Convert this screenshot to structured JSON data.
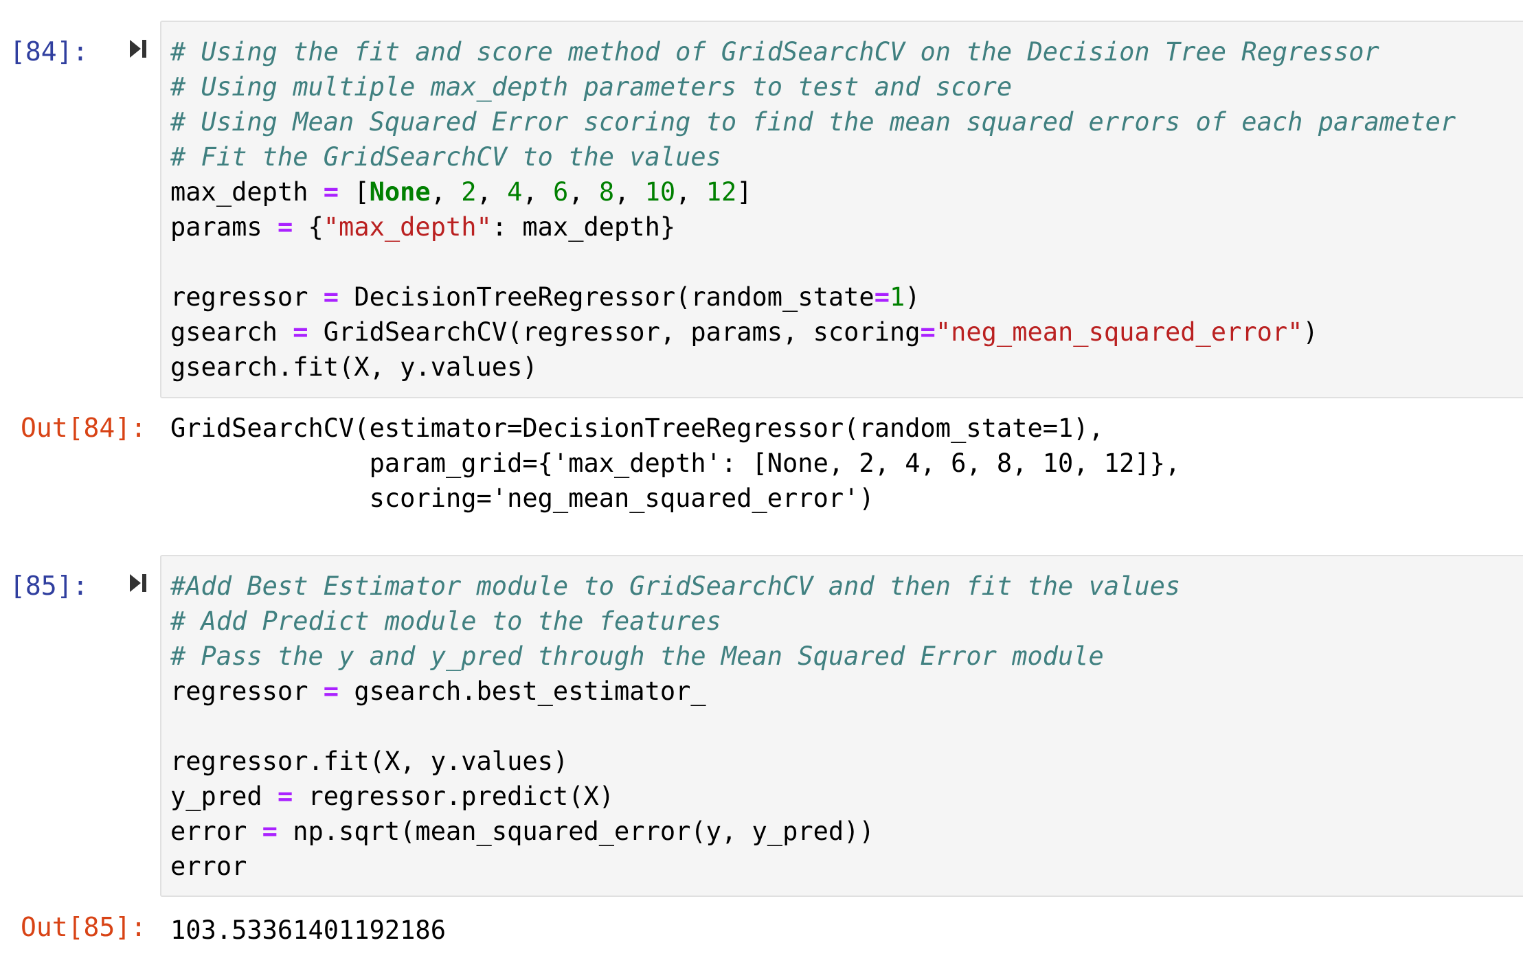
{
  "cells": [
    {
      "in_prompt": "[84]:",
      "out_prompt": "Out[84]:",
      "code": {
        "c1": "# Using the fit and score method of GridSearchCV on the Decision Tree Regressor",
        "c2": "# Using multiple max_depth parameters to test and score",
        "c3": "# Using Mean Squared Error scoring to find the mean squared errors of each parameter",
        "c4": "# Fit the GridSearchCV to the values",
        "l5_var": "max_depth",
        "eq": "=",
        "l5_open": "[",
        "none": "None",
        "n2": "2",
        "n4": "4",
        "n6": "6",
        "n8": "8",
        "n10": "10",
        "n12": "12",
        "comma": ",",
        "l5_close": "]",
        "l6_var": "params",
        "l6_open": "{",
        "l6_str": "\"max_depth\"",
        "l6_rest": ": max_depth}",
        "l8_var": "regressor",
        "l8_call": "DecisionTreeRegressor(random_state",
        "n1": "1",
        "close_paren": ")",
        "l9_var": "gsearch",
        "l9_call": "GridSearchCV(regressor, params, scoring",
        "l9_str": "\"neg_mean_squared_error\"",
        "l10": "gsearch.fit(X, y.values)"
      },
      "output": [
        "GridSearchCV(estimator=DecisionTreeRegressor(random_state=1),",
        "             param_grid={'max_depth': [None, 2, 4, 6, 8, 10, 12]},",
        "             scoring='neg_mean_squared_error')"
      ]
    },
    {
      "in_prompt": "[85]:",
      "out_prompt": "Out[85]:",
      "code": {
        "c1": "#Add Best Estimator module to GridSearchCV and then fit the values",
        "c2": "# Add Predict module to the features",
        "c3": "# Pass the y and y_pred through the Mean Squared Error module",
        "l4_var": "regressor",
        "eq": "=",
        "l4_rest": "gsearch.best_estimator_",
        "l6": "regressor.fit(X, y.values)",
        "l7_var": "y_pred",
        "l7_rest": "regressor.predict(X)",
        "l8_var": "error",
        "l8_rest": "np.sqrt(mean_squared_error(y, y_pred))",
        "l9": "error"
      },
      "output": [
        "103.53361401192186"
      ]
    }
  ]
}
